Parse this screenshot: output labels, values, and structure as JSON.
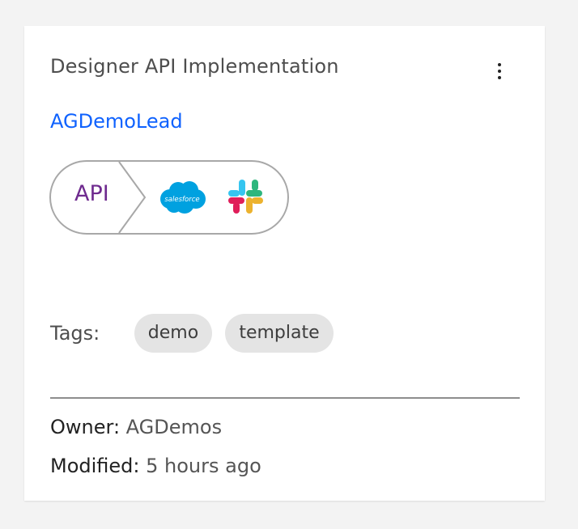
{
  "card": {
    "title": "Designer API Implementation",
    "lead_link": "AGDemoLead",
    "flow": {
      "trigger_label": "API",
      "connectors": [
        "salesforce-icon",
        "slack-icon"
      ],
      "salesforce_text": "salesforce"
    },
    "tags": {
      "label": "Tags:",
      "items": [
        "demo",
        "template"
      ]
    },
    "owner": {
      "label": "Owner:",
      "value": "AGDemos"
    },
    "modified": {
      "label": "Modified:",
      "value": "5 hours ago"
    }
  },
  "colors": {
    "link": "#0f62fe",
    "api_text": "#6f2b8f",
    "tag_bg": "#e4e4e4",
    "salesforce": "#00a1e0",
    "slack": [
      "#36c5f0",
      "#2eb67d",
      "#ecb22e",
      "#e01e5a"
    ]
  }
}
